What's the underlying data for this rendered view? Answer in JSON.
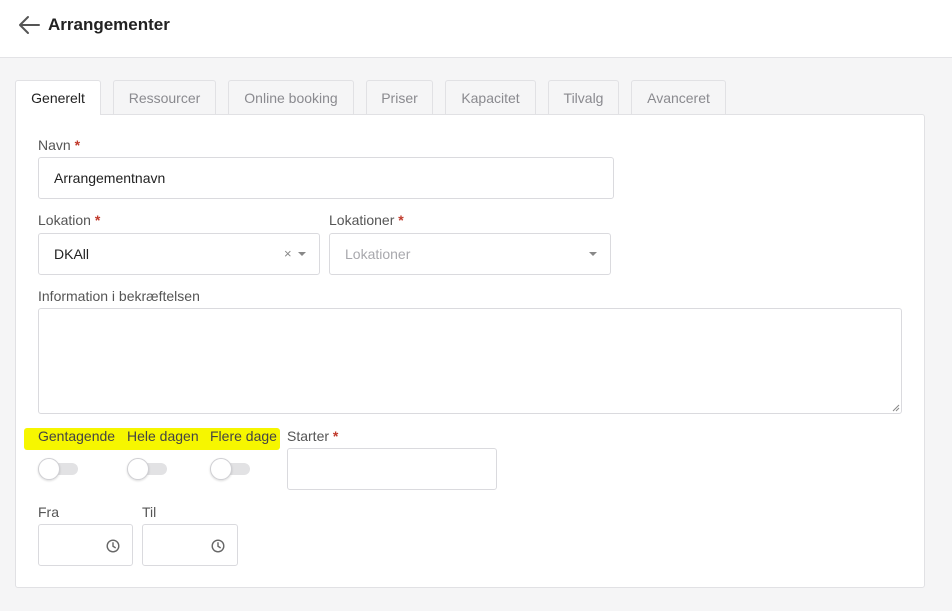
{
  "header": {
    "title": "Arrangementer",
    "back_icon": "arrow-left-icon"
  },
  "tabs": [
    {
      "label": "Generelt",
      "active": true
    },
    {
      "label": "Ressourcer"
    },
    {
      "label": "Online booking"
    },
    {
      "label": "Priser"
    },
    {
      "label": "Kapacitet"
    },
    {
      "label": "Tilvalg"
    },
    {
      "label": "Avanceret"
    }
  ],
  "form": {
    "name": {
      "label": "Navn",
      "required": "*",
      "value": "Arrangementnavn"
    },
    "location": {
      "label": "Lokation",
      "required": "*",
      "value": "DKAll",
      "clear": "×"
    },
    "locations": {
      "label": "Lokationer",
      "required": "*",
      "placeholder": "Lokationer"
    },
    "info": {
      "label": "Information i bekræftelsen",
      "value": ""
    },
    "toggles": [
      {
        "label": "Gentagende",
        "on": false
      },
      {
        "label": "Hele dagen",
        "on": false
      },
      {
        "label": "Flere dage",
        "on": false
      }
    ],
    "starts": {
      "label": "Starter",
      "required": "*",
      "value": ""
    },
    "from": {
      "label": "Fra",
      "value": "",
      "icon": "clock-icon"
    },
    "to": {
      "label": "Til",
      "value": "",
      "icon": "clock-icon"
    }
  },
  "colors": {
    "highlight": "#f6f600",
    "required": "#c0392b",
    "border": "#dadade"
  }
}
